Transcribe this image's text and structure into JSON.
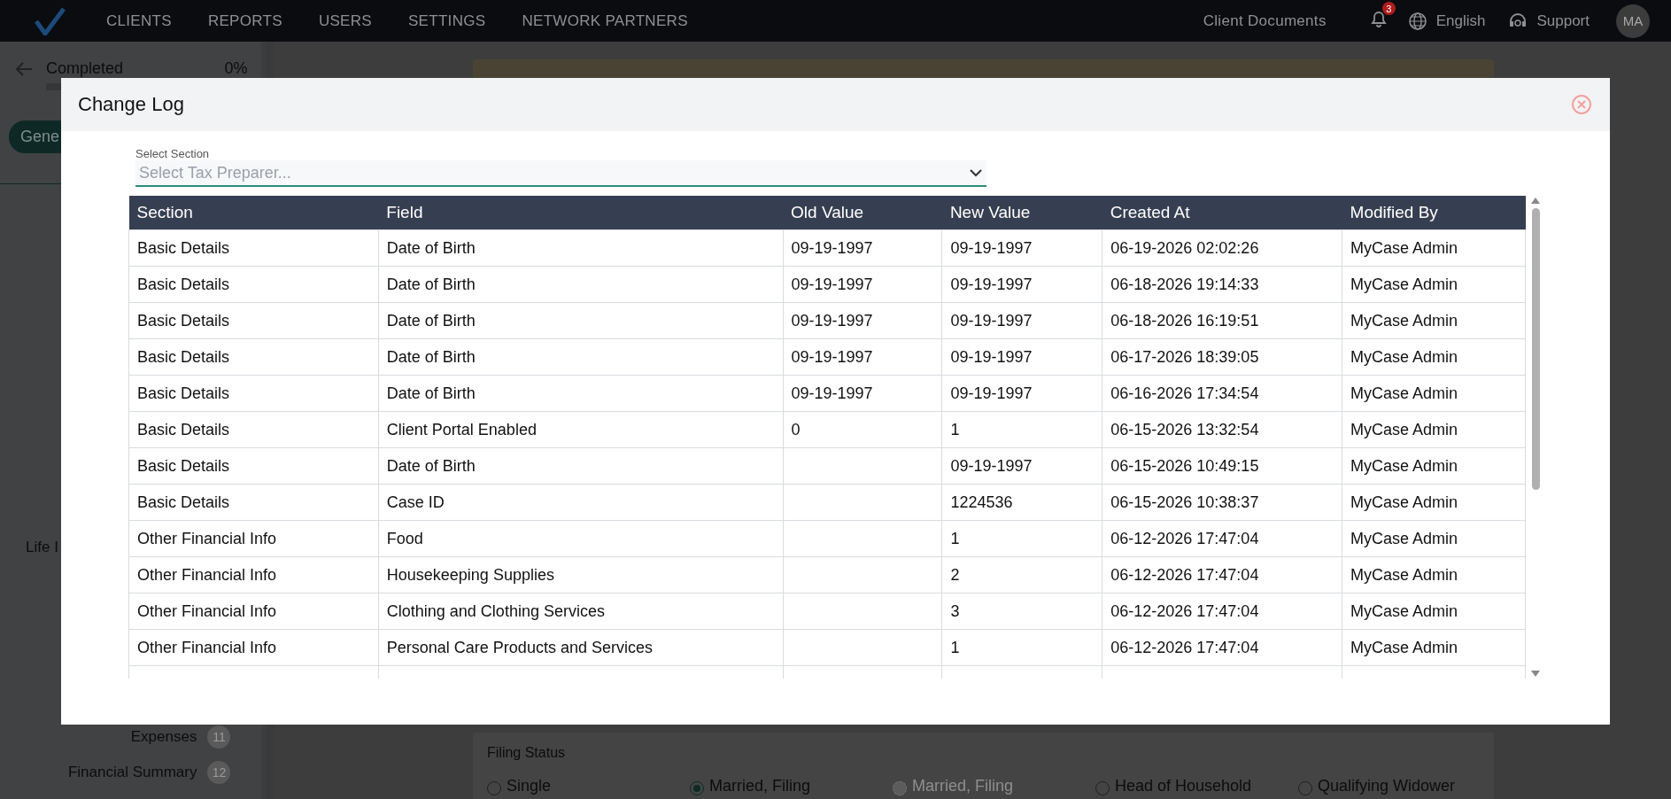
{
  "nav": {
    "items": [
      {
        "label": "CLIENTS"
      },
      {
        "label": "REPORTS"
      },
      {
        "label": "USERS"
      },
      {
        "label": "SETTINGS"
      },
      {
        "label": "NETWORK PARTNERS"
      }
    ],
    "documents_link": "Client Documents",
    "notification_count": "3",
    "language": "English",
    "support": "Support",
    "avatar_initials": "MA"
  },
  "background": {
    "progress": {
      "label": "Completed",
      "percent": "0%",
      "level": 0
    },
    "tab": "Gene",
    "sidebar_items": [
      {
        "label": "Life I"
      },
      {
        "label": "Expenses",
        "number": "11"
      },
      {
        "label": "Financial Summary",
        "number": "12"
      }
    ],
    "filing_status": {
      "label": "Filing Status",
      "options": [
        {
          "label": "Single",
          "selected": false,
          "disabled": false
        },
        {
          "label": "Married, Filing",
          "selected": true,
          "disabled": false
        },
        {
          "label": "Married, Filing",
          "selected": false,
          "disabled": true
        },
        {
          "label": "Head of Household",
          "selected": false,
          "disabled": false
        },
        {
          "label": "Qualifying Widower",
          "selected": false,
          "disabled": false
        }
      ]
    }
  },
  "modal": {
    "title": "Change Log",
    "select": {
      "label": "Select Section",
      "placeholder": "Select Tax Preparer..."
    },
    "table": {
      "columns": [
        "Section",
        "Field",
        "Old Value",
        "New Value",
        "Created At",
        "Modified By"
      ],
      "rows": [
        [
          "Basic Details",
          "Date of Birth",
          "09-19-1997",
          "09-19-1997",
          "06-19-2026 02:02:26",
          "MyCase Admin"
        ],
        [
          "Basic Details",
          "Date of Birth",
          "09-19-1997",
          "09-19-1997",
          "06-18-2026 19:14:33",
          "MyCase Admin"
        ],
        [
          "Basic Details",
          "Date of Birth",
          "09-19-1997",
          "09-19-1997",
          "06-18-2026 16:19:51",
          "MyCase Admin"
        ],
        [
          "Basic Details",
          "Date of Birth",
          "09-19-1997",
          "09-19-1997",
          "06-17-2026 18:39:05",
          "MyCase Admin"
        ],
        [
          "Basic Details",
          "Date of Birth",
          "09-19-1997",
          "09-19-1997",
          "06-16-2026 17:34:54",
          "MyCase Admin"
        ],
        [
          "Basic Details",
          "Client Portal Enabled",
          "0",
          "1",
          "06-15-2026 13:32:54",
          "MyCase Admin"
        ],
        [
          "Basic Details",
          "Date of Birth",
          "",
          "09-19-1997",
          "06-15-2026 10:49:15",
          "MyCase Admin"
        ],
        [
          "Basic Details",
          "Case ID",
          "",
          "1224536",
          "06-15-2026 10:38:37",
          "MyCase Admin"
        ],
        [
          "Other Financial Info",
          "Food",
          "",
          "1",
          "06-12-2026 17:47:04",
          "MyCase Admin"
        ],
        [
          "Other Financial Info",
          "Housekeeping Supplies",
          "",
          "2",
          "06-12-2026 17:47:04",
          "MyCase Admin"
        ],
        [
          "Other Financial Info",
          "Clothing and Clothing Services",
          "",
          "3",
          "06-12-2026 17:47:04",
          "MyCase Admin"
        ],
        [
          "Other Financial Info",
          "Personal Care Products and Services",
          "",
          "1",
          "06-12-2026 17:47:04",
          "MyCase Admin"
        ]
      ]
    }
  }
}
